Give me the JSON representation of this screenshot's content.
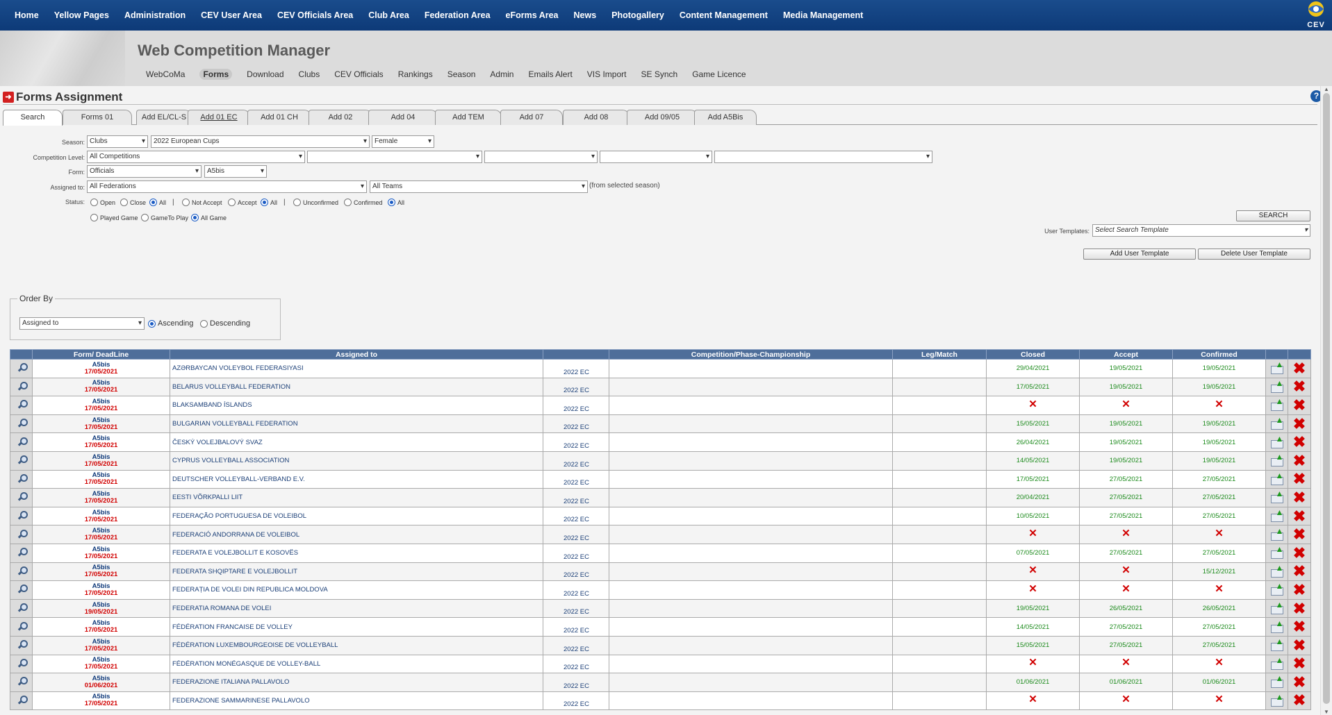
{
  "topnav": [
    "Home",
    "Yellow Pages",
    "Administration",
    "CEV User Area",
    "CEV Officials Area",
    "Club Area",
    "Federation Area",
    "eForms Area",
    "News",
    "Photogallery",
    "Content Management",
    "Media Management"
  ],
  "logo_text": "CEV",
  "app_title": "Web Competition Manager",
  "subnav": [
    "WebCoMa",
    "Forms",
    "Download",
    "Clubs",
    "CEV Officials",
    "Rankings",
    "Season",
    "Admin",
    "Emails Alert",
    "VIS Import",
    "SE Synch",
    "Game Licence"
  ],
  "subnav_active": "Forms",
  "page_title": "Forms Assignment",
  "help_icon": "?",
  "tabs": [
    "Search",
    "Forms 01",
    "Add EL/CL-S",
    "Add 01 EC",
    "Add 01 CH",
    "Add 02",
    "Add 04",
    "Add TEM",
    "Add 07",
    "Add 08",
    "Add 09/05",
    "Add A5Bis"
  ],
  "search": {
    "season_label": "Season:",
    "season_type": "Clubs",
    "season_value": "2022 European Cups",
    "gender": "Female",
    "competition_level_label": "Competition Level:",
    "competition_level": "All Competitions",
    "form_label": "Form:",
    "form_type": "Officials",
    "form_value": "A5bis",
    "assigned_label": "Assigned to:",
    "assigned_federation": "All Federations",
    "assigned_team": "All Teams",
    "from_season_note": "(from selected season)",
    "status_label": "Status:",
    "status_open": "Open",
    "status_close": "Close",
    "status_all1": "All",
    "status_notaccept": "Not Accept",
    "status_accept": "Accept",
    "status_all2": "All",
    "status_unconfirmed": "Unconfirmed",
    "status_confirmed": "Confirmed",
    "status_all3": "All",
    "game_played": "Played Game",
    "game_toplay": "GameTo Play",
    "game_all": "All Game",
    "pipe": "|",
    "search_button": "SEARCH",
    "user_templates_label": "User Templates:",
    "user_templates_placeholder": "Select Search Template",
    "add_template_button": "Add User Template",
    "delete_template_button": "Delete User Template"
  },
  "order_by": {
    "legend": "Order By",
    "field": "Assigned to",
    "ascending": "Ascending",
    "descending": "Descending"
  },
  "table": {
    "headers": [
      "Form/ DeadLine",
      "Assigned to",
      "Competition/Phase-Championship",
      "Leg/Match",
      "Closed",
      "Accept",
      "Confirmed"
    ],
    "rows": [
      {
        "form": "A5bis",
        "deadline": "17/05/2021",
        "assigned": "AZƏRBAYCAN VOLEYBOL FEDERASIYASI",
        "season": "2022 EC",
        "closed": "29/04/2021",
        "accept": "19/05/2021",
        "confirmed": "19/05/2021"
      },
      {
        "form": "A5bis",
        "deadline": "17/05/2021",
        "assigned": "BELARUS VOLLEYBALL FEDERATION",
        "season": "2022 EC",
        "closed": "17/05/2021",
        "accept": "19/05/2021",
        "confirmed": "19/05/2021"
      },
      {
        "form": "A5bis",
        "deadline": "17/05/2021",
        "assigned": "BLAKSAMBAND ÍSLANDS",
        "season": "2022 EC",
        "closed": "✕",
        "accept": "✕",
        "confirmed": "✕"
      },
      {
        "form": "A5bis",
        "deadline": "17/05/2021",
        "assigned": "BULGARIAN VOLLEYBALL FEDERATION",
        "season": "2022 EC",
        "closed": "15/05/2021",
        "accept": "19/05/2021",
        "confirmed": "19/05/2021"
      },
      {
        "form": "A5bis",
        "deadline": "17/05/2021",
        "assigned": "ČESKÝ VOLEJBALOVÝ SVAZ",
        "season": "2022 EC",
        "closed": "26/04/2021",
        "accept": "19/05/2021",
        "confirmed": "19/05/2021"
      },
      {
        "form": "A5bis",
        "deadline": "17/05/2021",
        "assigned": "CYPRUS VOLLEYBALL ASSOCIATION",
        "season": "2022 EC",
        "closed": "14/05/2021",
        "accept": "19/05/2021",
        "confirmed": "19/05/2021"
      },
      {
        "form": "A5bis",
        "deadline": "17/05/2021",
        "assigned": "DEUTSCHER VOLLEYBALL-VERBAND e.V.",
        "season": "2022 EC",
        "closed": "17/05/2021",
        "accept": "27/05/2021",
        "confirmed": "27/05/2021"
      },
      {
        "form": "A5bis",
        "deadline": "17/05/2021",
        "assigned": "EESTI VÕRKPALLI LIIT",
        "season": "2022 EC",
        "closed": "20/04/2021",
        "accept": "27/05/2021",
        "confirmed": "27/05/2021"
      },
      {
        "form": "A5bis",
        "deadline": "17/05/2021",
        "assigned": "FEDERAÇÃO PORTUGUESA DE VOLEIBOL",
        "season": "2022 EC",
        "closed": "10/05/2021",
        "accept": "27/05/2021",
        "confirmed": "27/05/2021"
      },
      {
        "form": "A5bis",
        "deadline": "17/05/2021",
        "assigned": "FEDERACIÓ ANDORRANA DE VOLEIBOL",
        "season": "2022 EC",
        "closed": "✕",
        "accept": "✕",
        "confirmed": "✕"
      },
      {
        "form": "A5bis",
        "deadline": "17/05/2021",
        "assigned": "FEDERATA E VOLEJBOLLIT E KOSOVËS",
        "season": "2022 EC",
        "closed": "07/05/2021",
        "accept": "27/05/2021",
        "confirmed": "27/05/2021"
      },
      {
        "form": "A5bis",
        "deadline": "17/05/2021",
        "assigned": "FEDERATA SHQIPTARE E VOLEJBOLLIT",
        "season": "2022 EC",
        "closed": "✕",
        "accept": "✕",
        "confirmed": "15/12/2021"
      },
      {
        "form": "A5bis",
        "deadline": "17/05/2021",
        "assigned": "FEDERAȚIA DE VOLEI DIN REPUBLICA MOLDOVA",
        "season": "2022 EC",
        "closed": "✕",
        "accept": "✕",
        "confirmed": "✕"
      },
      {
        "form": "A5bis",
        "deadline": "19/05/2021",
        "assigned": "FEDERATIA ROMANA DE VOLEI",
        "season": "2022 EC",
        "closed": "19/05/2021",
        "accept": "26/05/2021",
        "confirmed": "26/05/2021"
      },
      {
        "form": "A5bis",
        "deadline": "17/05/2021",
        "assigned": "FÉDÉRATION FRANCAISE DE VOLLEY",
        "season": "2022 EC",
        "closed": "14/05/2021",
        "accept": "27/05/2021",
        "confirmed": "27/05/2021"
      },
      {
        "form": "A5bis",
        "deadline": "17/05/2021",
        "assigned": "FÉDÉRATION LUXEMBOURGEOISE DE VOLLEYBALL",
        "season": "2022 EC",
        "closed": "15/05/2021",
        "accept": "27/05/2021",
        "confirmed": "27/05/2021"
      },
      {
        "form": "A5bis",
        "deadline": "17/05/2021",
        "assigned": "FÉDÉRATION MONÉGASQUE DE VOLLEY-BALL",
        "season": "2022 EC",
        "closed": "✕",
        "accept": "✕",
        "confirmed": "✕"
      },
      {
        "form": "A5bis",
        "deadline": "01/06/2021",
        "assigned": "FEDERAZIONE ITALIANA PALLAVOLO",
        "season": "2022 EC",
        "closed": "01/06/2021",
        "accept": "01/06/2021",
        "confirmed": "01/06/2021"
      },
      {
        "form": "A5bis",
        "deadline": "17/05/2021",
        "assigned": "FEDERAZIONE SAMMARINESE PALLAVOLO",
        "season": "2022 EC",
        "closed": "✕",
        "accept": "✕",
        "confirmed": "✕"
      }
    ]
  },
  "colors": {
    "nav": "#0d3a78",
    "header_bar": "#4e6e9a",
    "date_green": "#1b8a1b",
    "deadline_red": "#d10000"
  }
}
